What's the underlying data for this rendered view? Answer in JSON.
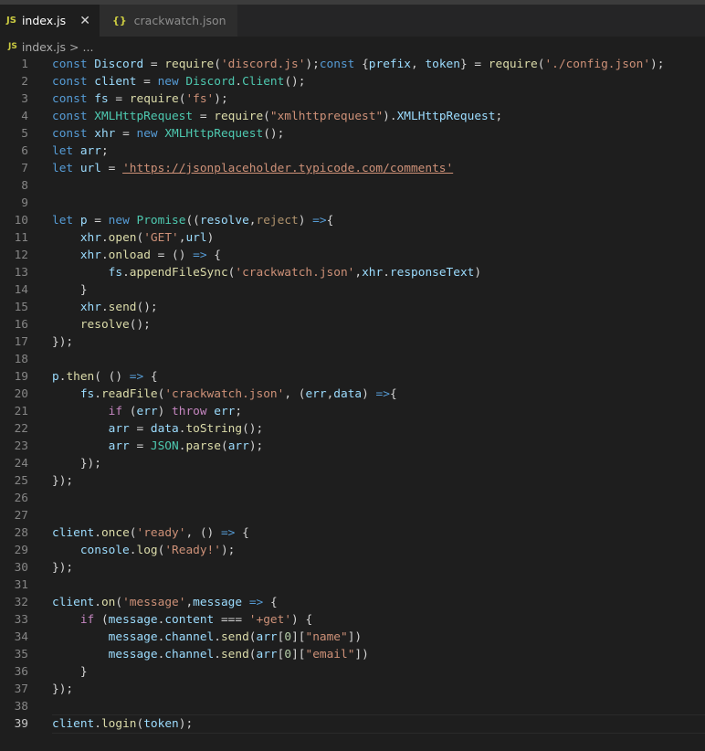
{
  "tabs": [
    {
      "label": "index.js",
      "icon": "JS",
      "active": true,
      "close": "✕"
    },
    {
      "label": "crackwatch.json",
      "icon": "{}",
      "active": false
    }
  ],
  "breadcrumb": {
    "icon": "JS",
    "file": "index.js",
    "separator": ">",
    "rest": "..."
  },
  "editor": {
    "current_line": 39,
    "lines": [
      [
        [
          "k",
          "const "
        ],
        [
          "v",
          "Discord"
        ],
        [
          "p",
          " = "
        ],
        [
          "f",
          "require"
        ],
        [
          "p",
          "("
        ],
        [
          "s",
          "'discord.js'"
        ],
        [
          "p",
          ");"
        ],
        [
          "k",
          "const "
        ],
        [
          "p",
          "{"
        ],
        [
          "v",
          "prefix"
        ],
        [
          "p",
          ", "
        ],
        [
          "v",
          "token"
        ],
        [
          "p",
          "} = "
        ],
        [
          "f",
          "require"
        ],
        [
          "p",
          "("
        ],
        [
          "s",
          "'./config.json'"
        ],
        [
          "p",
          ");"
        ]
      ],
      [
        [
          "k",
          "const "
        ],
        [
          "v",
          "client"
        ],
        [
          "p",
          " = "
        ],
        [
          "k",
          "new "
        ],
        [
          "c",
          "Discord"
        ],
        [
          "p",
          "."
        ],
        [
          "c",
          "Client"
        ],
        [
          "p",
          "();"
        ]
      ],
      [
        [
          "k",
          "const "
        ],
        [
          "v",
          "fs"
        ],
        [
          "p",
          " = "
        ],
        [
          "f",
          "require"
        ],
        [
          "p",
          "("
        ],
        [
          "s",
          "'fs'"
        ],
        [
          "p",
          ");"
        ]
      ],
      [
        [
          "k",
          "const "
        ],
        [
          "c",
          "XMLHttpRequest"
        ],
        [
          "p",
          " = "
        ],
        [
          "f",
          "require"
        ],
        [
          "p",
          "("
        ],
        [
          "s",
          "\"xmlhttprequest\""
        ],
        [
          "p",
          ")."
        ],
        [
          "v",
          "XMLHttpRequest"
        ],
        [
          "p",
          ";"
        ]
      ],
      [
        [
          "k",
          "const "
        ],
        [
          "v",
          "xhr"
        ],
        [
          "p",
          " = "
        ],
        [
          "k",
          "new "
        ],
        [
          "c",
          "XMLHttpRequest"
        ],
        [
          "p",
          "();"
        ]
      ],
      [
        [
          "k",
          "let "
        ],
        [
          "v",
          "arr"
        ],
        [
          "p",
          ";"
        ]
      ],
      [
        [
          "k",
          "let "
        ],
        [
          "v",
          "url"
        ],
        [
          "p",
          " = "
        ],
        [
          "s ul",
          "'https://jsonplaceholder.typicode.com/comments'"
        ]
      ],
      [],
      [],
      [
        [
          "k",
          "let "
        ],
        [
          "v",
          "p"
        ],
        [
          "p",
          " = "
        ],
        [
          "k",
          "new "
        ],
        [
          "c",
          "Promise"
        ],
        [
          "p",
          "(("
        ],
        [
          "v",
          "resolve"
        ],
        [
          "p",
          ","
        ],
        [
          "u",
          "reject"
        ],
        [
          "p",
          ") "
        ],
        [
          "k",
          "=>"
        ],
        [
          "p",
          "{"
        ]
      ],
      [
        [
          "p",
          "    "
        ],
        [
          "v",
          "xhr"
        ],
        [
          "p",
          "."
        ],
        [
          "f",
          "open"
        ],
        [
          "p",
          "("
        ],
        [
          "s",
          "'GET'"
        ],
        [
          "p",
          ","
        ],
        [
          "v",
          "url"
        ],
        [
          "p",
          ")"
        ]
      ],
      [
        [
          "p",
          "    "
        ],
        [
          "v",
          "xhr"
        ],
        [
          "p",
          "."
        ],
        [
          "f",
          "onload"
        ],
        [
          "p",
          " = () "
        ],
        [
          "k",
          "=>"
        ],
        [
          "p",
          " {"
        ]
      ],
      [
        [
          "p",
          "        "
        ],
        [
          "v",
          "fs"
        ],
        [
          "p",
          "."
        ],
        [
          "f",
          "appendFileSync"
        ],
        [
          "p",
          "("
        ],
        [
          "s",
          "'crackwatch.json'"
        ],
        [
          "p",
          ","
        ],
        [
          "v",
          "xhr"
        ],
        [
          "p",
          "."
        ],
        [
          "v",
          "responseText"
        ],
        [
          "p",
          ")"
        ]
      ],
      [
        [
          "p",
          "    }"
        ]
      ],
      [
        [
          "p",
          "    "
        ],
        [
          "v",
          "xhr"
        ],
        [
          "p",
          "."
        ],
        [
          "f",
          "send"
        ],
        [
          "p",
          "();"
        ]
      ],
      [
        [
          "p",
          "    "
        ],
        [
          "f",
          "resolve"
        ],
        [
          "p",
          "();"
        ]
      ],
      [
        [
          "p",
          "});"
        ]
      ],
      [],
      [
        [
          "v",
          "p"
        ],
        [
          "p",
          "."
        ],
        [
          "f",
          "then"
        ],
        [
          "p",
          "( () "
        ],
        [
          "k",
          "=>"
        ],
        [
          "p",
          " {"
        ]
      ],
      [
        [
          "p",
          "    "
        ],
        [
          "v",
          "fs"
        ],
        [
          "p",
          "."
        ],
        [
          "f",
          "readFile"
        ],
        [
          "p",
          "("
        ],
        [
          "s",
          "'crackwatch.json'"
        ],
        [
          "p",
          ", ("
        ],
        [
          "v",
          "err"
        ],
        [
          "p",
          ","
        ],
        [
          "v",
          "data"
        ],
        [
          "p",
          ") "
        ],
        [
          "k",
          "=>"
        ],
        [
          "p",
          "{"
        ]
      ],
      [
        [
          "p",
          "        "
        ],
        [
          "r",
          "if"
        ],
        [
          "p",
          " ("
        ],
        [
          "v",
          "err"
        ],
        [
          "p",
          ") "
        ],
        [
          "r",
          "throw "
        ],
        [
          "v",
          "err"
        ],
        [
          "p",
          ";"
        ]
      ],
      [
        [
          "p",
          "        "
        ],
        [
          "v",
          "arr"
        ],
        [
          "p",
          " = "
        ],
        [
          "v",
          "data"
        ],
        [
          "p",
          "."
        ],
        [
          "f",
          "toString"
        ],
        [
          "p",
          "();"
        ]
      ],
      [
        [
          "p",
          "        "
        ],
        [
          "v",
          "arr"
        ],
        [
          "p",
          " = "
        ],
        [
          "c",
          "JSON"
        ],
        [
          "p",
          "."
        ],
        [
          "f",
          "parse"
        ],
        [
          "p",
          "("
        ],
        [
          "v",
          "arr"
        ],
        [
          "p",
          ");"
        ]
      ],
      [
        [
          "p",
          "    });"
        ]
      ],
      [
        [
          "p",
          "});"
        ]
      ],
      [],
      [],
      [
        [
          "v",
          "client"
        ],
        [
          "p",
          "."
        ],
        [
          "f",
          "once"
        ],
        [
          "p",
          "("
        ],
        [
          "s",
          "'ready'"
        ],
        [
          "p",
          ", () "
        ],
        [
          "k",
          "=>"
        ],
        [
          "p",
          " {"
        ]
      ],
      [
        [
          "p",
          "    "
        ],
        [
          "v",
          "console"
        ],
        [
          "p",
          "."
        ],
        [
          "f",
          "log"
        ],
        [
          "p",
          "("
        ],
        [
          "s",
          "'Ready!'"
        ],
        [
          "p",
          ");"
        ]
      ],
      [
        [
          "p",
          "});"
        ]
      ],
      [],
      [
        [
          "v",
          "client"
        ],
        [
          "p",
          "."
        ],
        [
          "f",
          "on"
        ],
        [
          "p",
          "("
        ],
        [
          "s",
          "'message'"
        ],
        [
          "p",
          ","
        ],
        [
          "v",
          "message"
        ],
        [
          "p",
          " "
        ],
        [
          "k",
          "=>"
        ],
        [
          "p",
          " {"
        ]
      ],
      [
        [
          "p",
          "    "
        ],
        [
          "r",
          "if"
        ],
        [
          "p",
          " ("
        ],
        [
          "v",
          "message"
        ],
        [
          "p",
          "."
        ],
        [
          "v",
          "content"
        ],
        [
          "p",
          " === "
        ],
        [
          "s",
          "'+get'"
        ],
        [
          "p",
          ") {"
        ]
      ],
      [
        [
          "p",
          "        "
        ],
        [
          "v",
          "message"
        ],
        [
          "p",
          "."
        ],
        [
          "v",
          "channel"
        ],
        [
          "p",
          "."
        ],
        [
          "f",
          "send"
        ],
        [
          "p",
          "("
        ],
        [
          "v",
          "arr"
        ],
        [
          "p",
          "["
        ],
        [
          "n",
          "0"
        ],
        [
          "p",
          "]["
        ],
        [
          "s",
          "\"name\""
        ],
        [
          "p",
          "])"
        ]
      ],
      [
        [
          "p",
          "        "
        ],
        [
          "v",
          "message"
        ],
        [
          "p",
          "."
        ],
        [
          "v",
          "channel"
        ],
        [
          "p",
          "."
        ],
        [
          "f",
          "send"
        ],
        [
          "p",
          "("
        ],
        [
          "v",
          "arr"
        ],
        [
          "p",
          "["
        ],
        [
          "n",
          "0"
        ],
        [
          "p",
          "]["
        ],
        [
          "s",
          "\"email\""
        ],
        [
          "p",
          "])"
        ]
      ],
      [
        [
          "p",
          "    }"
        ]
      ],
      [
        [
          "p",
          "});"
        ]
      ],
      [],
      [
        [
          "v",
          "client"
        ],
        [
          "p",
          "."
        ],
        [
          "f",
          "login"
        ],
        [
          "p",
          "("
        ],
        [
          "v",
          "token"
        ],
        [
          "p",
          ");"
        ]
      ]
    ]
  }
}
